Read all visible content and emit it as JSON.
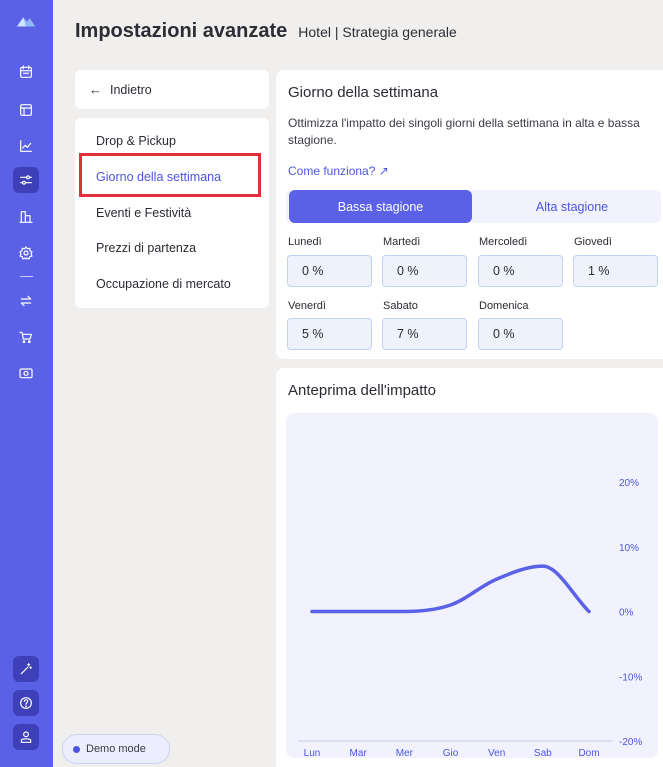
{
  "header": {
    "title": "Impostazioni avanzate",
    "subtitle": "Hotel | Strategia generale"
  },
  "subnav": {
    "back_label": "Indietro",
    "items": [
      {
        "label": "Drop & Pickup"
      },
      {
        "label": "Giorno della settimana",
        "active": true
      },
      {
        "label": "Eventi e Festività"
      },
      {
        "label": "Prezzi di partenza"
      },
      {
        "label": "Occupazione di mercato"
      }
    ]
  },
  "weekday_card": {
    "title": "Giorno della settimana",
    "description": "Ottimizza l'impatto dei singoli giorni della settimana in alta e bassa stagione.",
    "help_link": "Come funziona? ↗",
    "seasons": {
      "low": "Bassa stagione",
      "high": "Alta stagione",
      "selected": "low"
    },
    "days": [
      {
        "label": "Lunedì",
        "value": "0 %"
      },
      {
        "label": "Martedì",
        "value": "0 %"
      },
      {
        "label": "Mercoledì",
        "value": "0 %"
      },
      {
        "label": "Giovedì",
        "value": "1 %"
      },
      {
        "label": "Venerdì",
        "value": "5 %"
      },
      {
        "label": "Sabato",
        "value": "7 %"
      },
      {
        "label": "Domenica",
        "value": "0 %"
      }
    ]
  },
  "preview_card": {
    "title": "Anteprima dell'impatto"
  },
  "chart_data": {
    "type": "line",
    "title": "",
    "categories": [
      "Lun",
      "Mar",
      "Mer",
      "Gio",
      "Ven",
      "Sab",
      "Dom"
    ],
    "series": [
      {
        "values": [
          0,
          0,
          0,
          1,
          5,
          7,
          0
        ]
      }
    ],
    "y_ticks": [
      "20%",
      "10%",
      "0%",
      "-10%",
      "-20%"
    ],
    "ylim": [
      -20,
      20
    ],
    "y_axis_position": "right",
    "line_color": "#5a61e6"
  },
  "demo_mode": {
    "label": "Demo mode"
  },
  "rail_icons": [
    "logo-icon",
    "calendar-icon",
    "layout-icon",
    "chart-icon",
    "sliders-icon",
    "building-icon",
    "settings-icon",
    "swap-icon",
    "cart-icon",
    "money-icon",
    "magic-wand-icon",
    "help-icon",
    "user-icon"
  ],
  "colors": {
    "accent": "#5a61e6",
    "highlight": "#e0303a"
  }
}
